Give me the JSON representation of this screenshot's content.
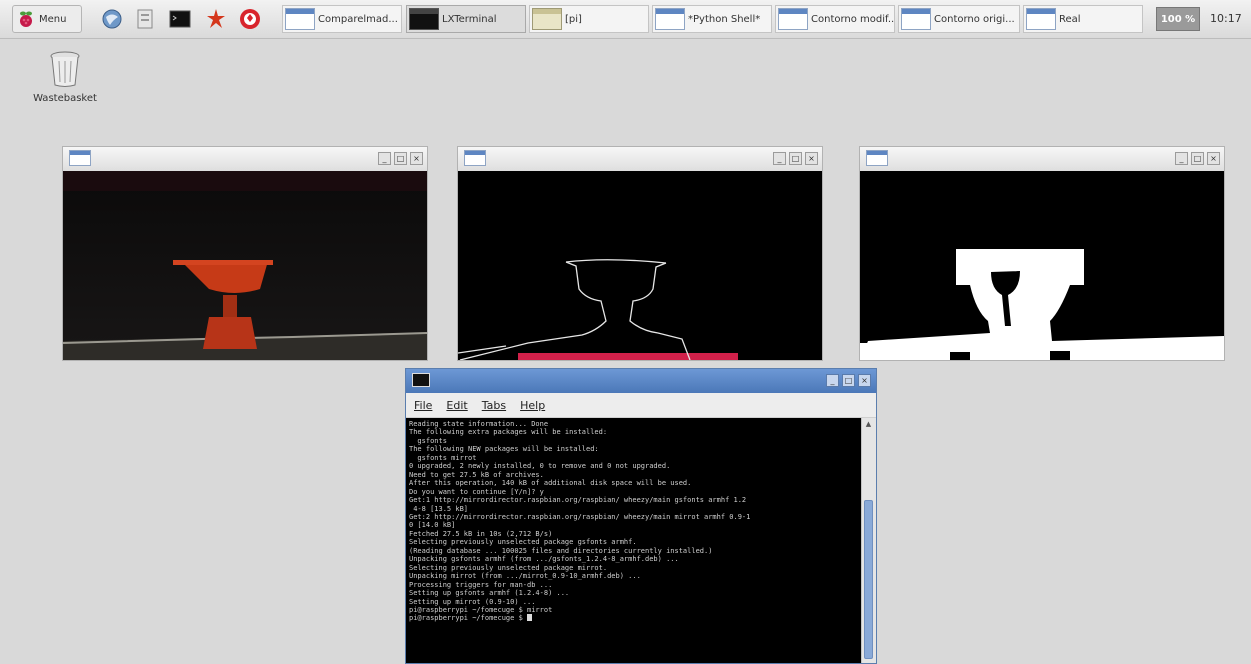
{
  "taskbar": {
    "menu_label": "Menu",
    "tasks": [
      {
        "label": "Comparelmad..."
      },
      {
        "label": "LXTerminal"
      },
      {
        "label": "[pi]"
      },
      {
        "label": "*Python Shell*"
      },
      {
        "label": "Contorno modif..."
      },
      {
        "label": "Contorno origi..."
      },
      {
        "label": "Real"
      }
    ],
    "cpu": "100 %",
    "clock": "10:17"
  },
  "desktop": {
    "wastebasket_label": "Wastebasket"
  },
  "terminal": {
    "menu": [
      "File",
      "Edit",
      "Tabs",
      "Help"
    ],
    "lines": [
      "Reading state information... Done",
      "The following extra packages will be installed:",
      "  gsfonts",
      "The following NEW packages will be installed:",
      "  gsfonts mirrot",
      "0 upgraded, 2 newly installed, 0 to remove and 0 not upgraded.",
      "Need to get 27.5 kB of archives.",
      "After this operation, 140 kB of additional disk space will be used.",
      "Do you want to continue [Y/n]? y",
      "Get:1 http://mirrordirector.raspbian.org/raspbian/ wheezy/main gsfonts armhf 1.2",
      " 4-8 [13.5 kB]",
      "Get:2 http://mirrordirector.raspbian.org/raspbian/ wheezy/main mirrot armhf 0.9-1",
      "0 [14.0 kB]",
      "Fetched 27.5 kB in 10s (2,712 B/s)",
      "Selecting previously unselected package gsfonts armhf.",
      "(Reading database ... 100025 files and directories currently installed.)",
      "Unpacking gsfonts armhf (from .../gsfonts_1.2.4-8_armhf.deb) ...",
      "Selecting previously unselected package mirrot.",
      "Unpacking mirrot (from .../mirrot_0.9-10_armhf.deb) ...",
      "Processing triggers for man-db ...",
      "Setting up gsfonts armhf (1.2.4-8) ...",
      "Setting up mirrot (0.9-10) ...",
      "pi@raspberrypi ~/fomecuge $ mirrot",
      "pi@raspberrypi ~/fomecuge $ "
    ]
  }
}
